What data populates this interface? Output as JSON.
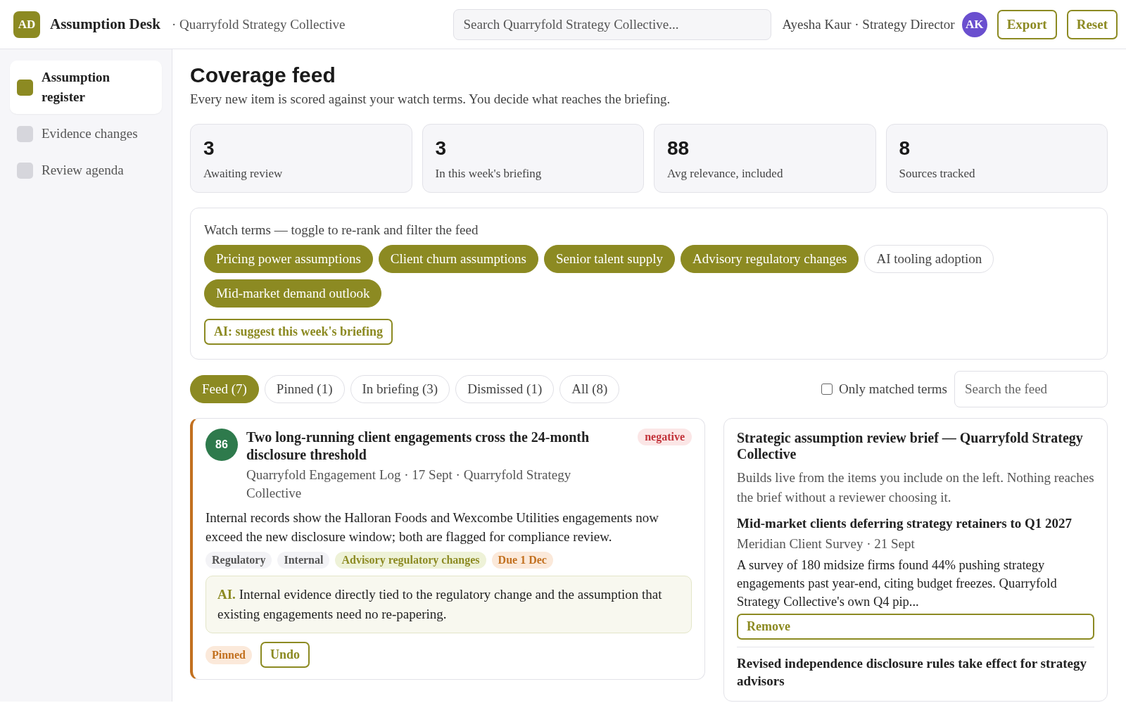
{
  "app": {
    "logo": "AD",
    "title": "Assumption Desk",
    "org": "· Quarryfold Strategy Collective"
  },
  "search": {
    "placeholder": "Search Quarryfold Strategy Collective..."
  },
  "user": {
    "name": "Ayesha Kaur · Strategy Director",
    "initials": "AK"
  },
  "header_buttons": [
    "Export",
    "Reset"
  ],
  "sidebar": {
    "items": [
      {
        "label": "Assumption register",
        "selected": true
      },
      {
        "label": "Evidence changes",
        "selected": false
      },
      {
        "label": "Review agenda",
        "selected": false
      }
    ]
  },
  "page": {
    "title": "Coverage feed",
    "subtitle": "Every new item is scored against your watch terms. You decide what reaches the briefing."
  },
  "stats": [
    {
      "value": "3",
      "label": "Awaiting review"
    },
    {
      "value": "3",
      "label": "In this week's briefing"
    },
    {
      "value": "88",
      "label": "Avg relevance, included"
    },
    {
      "value": "8",
      "label": "Sources tracked"
    }
  ],
  "watch_terms": {
    "label": "Watch terms — toggle to re-rank and filter the feed",
    "terms": [
      {
        "label": "Pricing power assumptions",
        "on": true
      },
      {
        "label": "Client churn assumptions",
        "on": true
      },
      {
        "label": "Senior talent supply",
        "on": true
      },
      {
        "label": "Advisory regulatory changes",
        "on": true
      },
      {
        "label": "AI tooling adoption",
        "on": false
      },
      {
        "label": "Mid-market demand outlook",
        "on": true
      }
    ],
    "ai_button": "AI: suggest this week's briefing"
  },
  "filter_tabs": [
    {
      "label": "Feed (7)",
      "selected": true
    },
    {
      "label": "Pinned (1)",
      "selected": false
    },
    {
      "label": "In briefing (3)",
      "selected": false
    },
    {
      "label": "Dismissed (1)",
      "selected": false
    },
    {
      "label": "All (8)",
      "selected": false
    }
  ],
  "only_matched": {
    "label": "Only matched terms",
    "checked": false
  },
  "feed_search": {
    "placeholder": "Search the feed"
  },
  "feed_items": [
    {
      "score": "86",
      "title": "Two long-running client engagements cross the 24-month disclosure threshold",
      "sentiment": "negative",
      "meta": "Quarryfold Engagement Log · 17 Sept · Quarryfold Strategy Collective",
      "summary": "Internal records show the Halloran Foods and Wexcombe Utilities engagements now exceed the new disclosure window; both are flagged for compliance review.",
      "tags": [
        {
          "label": "Regulatory",
          "kind": "category"
        },
        {
          "label": "Internal",
          "kind": "category"
        },
        {
          "label": "Advisory regulatory changes",
          "kind": "term"
        },
        {
          "label": "Due 1 Dec",
          "kind": "due"
        }
      ],
      "ai_note": "**AI.** Internal evidence directly tied to the regulatory change and the assumption that existing engagements need no re-papering.",
      "pinned": true,
      "status": "Pinned",
      "action": "Undo"
    }
  ],
  "brief": {
    "title": "Strategic assumption review brief — Quarryfold Strategy Collective",
    "subtitle": "Builds live from the items you include on the left. Nothing reaches the brief without a reviewer choosing it.",
    "items": [
      {
        "title": "Mid-market clients deferring strategy retainers to Q1 2027",
        "meta": "Meridian Client Survey · 21 Sept",
        "summary": "A survey of 180 midsize firms found 44% pushing strategy engagements past year-end, citing budget freezes. Quarryfold Strategy Collective's own Q4 pip...",
        "action": "Remove"
      },
      {
        "title": "Revised independence disclosure rules take effect for strategy advisors"
      }
    ]
  }
}
